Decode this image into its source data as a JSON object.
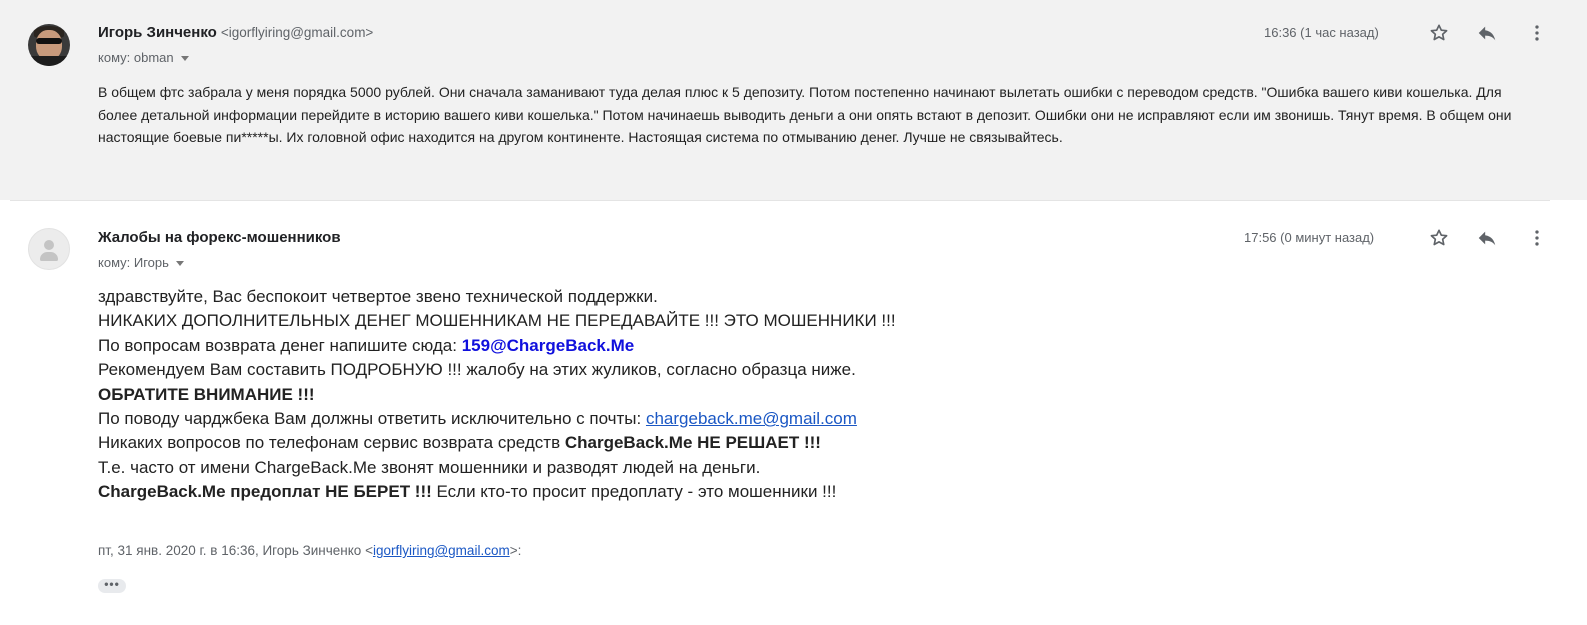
{
  "messages": [
    {
      "sender_name": "Игорь Зинченко",
      "sender_email": "<igorflyiring@gmail.com>",
      "to_label": "кому: obman",
      "time": "16:36 (1 час назад)",
      "body_text": "В общем фтс забрала у меня порядка 5000 рублей. Они сначала заманивают туда делая плюс к 5 депозиту. Потом постепенно начинают вылетать ошибки с переводом средств. \"Ошибка вашего киви кошелька. Для более детальной информации перейдите в историю вашего киви кошелька.\" Потом начинаешь выводить деньги а они опять встают в депозит. Ошибки они не исправляют если им звонишь. Тянут время. В общем они настоящие боевые пи*****ы. Их головной офис находится на другом континенте. Настоящая система по отмыванию денег. Лучше не связывайтесь."
    },
    {
      "sender_name": "Жалобы на форекс-мошенников",
      "to_label": "кому: Игорь",
      "time": "17:56 (0 минут назад)",
      "body": {
        "line1": "здравствуйте, Вас беспокоит четвертое звено технической поддержки.",
        "line2": "НИКАКИХ ДОПОЛНИТЕЛЬНЫХ ДЕНЕГ МОШЕННИКАМ НЕ ПЕРЕДАВАЙТЕ !!! ЭТО МОШЕННИКИ !!!",
        "line3_prefix": "По вопросам возврата денег напишите сюда: ",
        "line3_link": "159@ChargeBack.Me",
        "line4": "Рекомендуем Вам составить ПОДРОБНУЮ !!! жалобу на этих жуликов, согласно образца ниже.",
        "line5": "ОБРАТИТЕ ВНИМАНИЕ !!!",
        "line6_prefix": "По поводу чарджбека Вам должны ответить исключительно с почты: ",
        "line6_link": "chargeback.me@gmail.com",
        "line7_prefix": "Никаких вопросов по телефонам сервис возврата средств ",
        "line7_bold": "ChargeBack.Me НЕ РЕШАЕТ !!!",
        "line8": "Т.е. часто от имени ChargeBack.Me звонят мошенники и разводят людей на деньги.",
        "line9_bold": "ChargeBack.Me предоплат НЕ БЕРЕТ !!!",
        "line9_suffix": " Если кто-то просит предоплату - это мошенники !!!"
      },
      "quote": {
        "prefix": "пт, 31 янв. 2020 г. в 16:36, Игорь Зинченко <",
        "email_link": "igorflyiring@gmail.com",
        "suffix": ">:"
      },
      "ellipsis": "•••"
    }
  ],
  "icons": [
    "avatar-photo",
    "default-avatar-icon",
    "star-icon",
    "reply-icon",
    "more-vert-icon",
    "chevron-down-icon"
  ],
  "colors": {
    "background_selected": "#f2f2f2",
    "link_blue": "#1010dd",
    "link_underline": "#1a57c4",
    "muted_text": "#5f6368"
  }
}
